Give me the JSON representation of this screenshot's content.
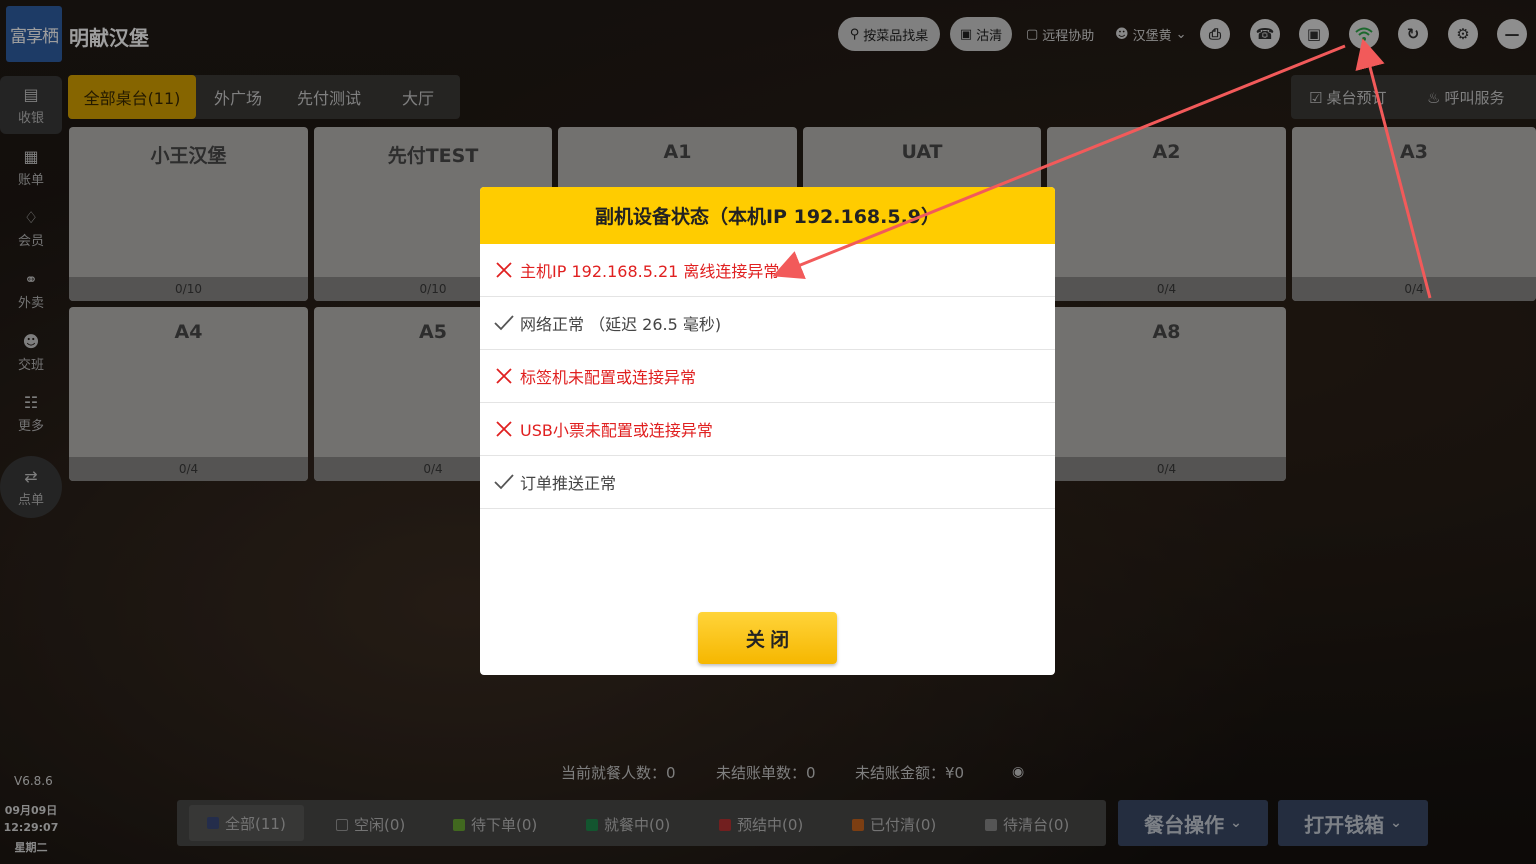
{
  "app": {
    "logo_text": "富享栖",
    "brand": "明献汉堡"
  },
  "topbar": {
    "search_label": "按菜品找桌",
    "clear_label": "沽清",
    "remote_label": "远程协助",
    "user_label": "汉堡黄",
    "icons": [
      "printer-icon",
      "support-icon",
      "monitor-icon",
      "wifi-icon",
      "refresh-icon",
      "settings-icon",
      "minimize-icon"
    ]
  },
  "sidebar": {
    "items": [
      {
        "label": "收银",
        "icon": "cashier-icon"
      },
      {
        "label": "账单",
        "icon": "bill-icon"
      },
      {
        "label": "会员",
        "icon": "member-icon"
      },
      {
        "label": "外卖",
        "icon": "takeout-icon"
      },
      {
        "label": "交班",
        "icon": "shift-icon"
      },
      {
        "label": "更多",
        "icon": "more-icon"
      },
      {
        "label": "点单",
        "icon": "order-icon"
      }
    ],
    "version": "V6.8.6",
    "date": "09月09日",
    "time": "12:29:07",
    "weekday": "星期二"
  },
  "area_tabs": [
    {
      "label": "全部桌台(11)",
      "active": true
    },
    {
      "label": "外广场",
      "active": false
    },
    {
      "label": "先付测试",
      "active": false
    },
    {
      "label": "大厅",
      "active": false
    }
  ],
  "right_buttons": {
    "reserve": "桌台预订",
    "call": "呼叫服务"
  },
  "tables": [
    {
      "name": "小王汉堡",
      "seats": "0/10"
    },
    {
      "name": "先付TEST",
      "seats": "0/10"
    },
    {
      "name": "A1",
      "seats": ""
    },
    {
      "name": "UAT",
      "seats": ""
    },
    {
      "name": "A2",
      "seats": "0/4"
    },
    {
      "name": "A3",
      "seats": "0/4"
    },
    {
      "name": "A4",
      "seats": "0/4"
    },
    {
      "name": "A5",
      "seats": "0/4"
    },
    {
      "name": "A8",
      "seats": "0/4"
    }
  ],
  "dialog": {
    "title": "副机设备状态（本机IP 192.168.5.9）",
    "rows": [
      {
        "status": "error",
        "text": "主机IP 192.168.5.21 离线连接异常"
      },
      {
        "status": "ok",
        "text": "网络正常 （延迟 26.5 毫秒)"
      },
      {
        "status": "error",
        "text": "标签机未配置或连接异常"
      },
      {
        "status": "error",
        "text": "USB小票未配置或连接异常"
      },
      {
        "status": "ok",
        "text": "订单推送正常"
      }
    ],
    "close_label": "关 闭"
  },
  "stats": {
    "diners": "当前就餐人数：0",
    "open_bills": "未结账单数：0",
    "open_amount": "未结账金额：¥0"
  },
  "legend": [
    {
      "label": "全部(11)",
      "color": "#3b4a7a"
    },
    {
      "label": "空闲(0)",
      "color": "#4a4948"
    },
    {
      "label": "待下单(0)",
      "color": "#6aa832"
    },
    {
      "label": "就餐中(0)",
      "color": "#1f8a4c"
    },
    {
      "label": "预结中(0)",
      "color": "#b83232"
    },
    {
      "label": "已付清(0)",
      "color": "#c8641e"
    },
    {
      "label": "待清台(0)",
      "color": "#8a8a8a"
    }
  ],
  "bottom_buttons": {
    "table_ops": "餐台操作",
    "cash_drawer": "打开钱箱"
  },
  "colors": {
    "accent": "#ffcc00",
    "error": "#e02020",
    "annotation": "#f25a5a"
  }
}
